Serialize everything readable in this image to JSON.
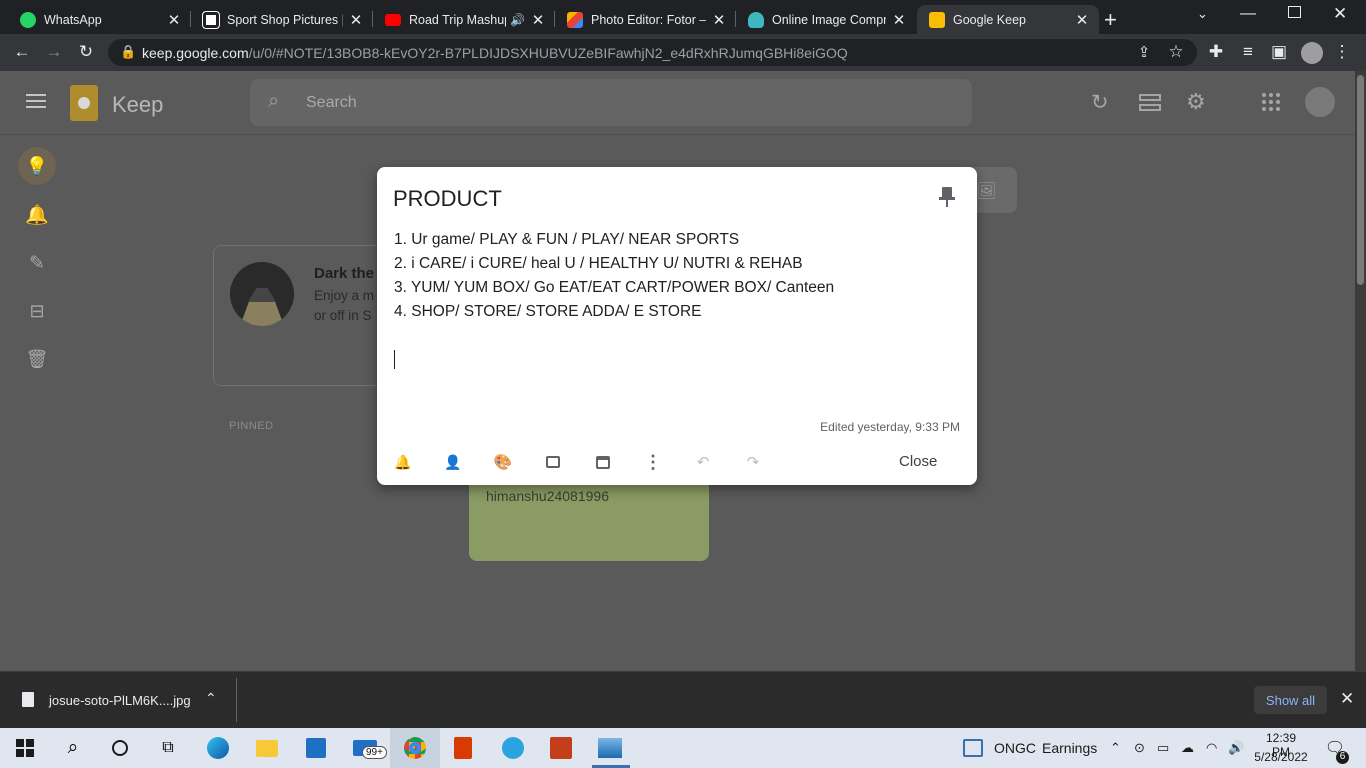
{
  "browser": {
    "tabs": [
      {
        "title": "WhatsApp",
        "icon": "whatsapp-icon",
        "color": "#25d366"
      },
      {
        "title": "Sport Shop Pictures | U",
        "icon": "unsplash-icon",
        "color": "#ffffff"
      },
      {
        "title": "Road Trip Mashup",
        "icon": "youtube-icon",
        "color": "#ff0000"
      },
      {
        "title": "Photo Editor: Fotor – F",
        "icon": "fotor-icon",
        "color": "#f4b400"
      },
      {
        "title": "Online Image Compre",
        "icon": "compressor-icon",
        "color": "#3fb7c0"
      },
      {
        "title": "Google Keep",
        "icon": "keep-icon",
        "color": "#fbbc04"
      }
    ],
    "new_tab": "+",
    "url_host": "keep.google.com",
    "url_path": "/u/0/#NOTE/13BOB8-kEvOY2r-B7PLDIJDSXHUBVUZeBIFawhjN2_e4dRxhRJumqGBHi8eiGOQ"
  },
  "keep": {
    "app_name": "Keep",
    "search_placeholder": "Search",
    "dark_card": {
      "title": "Dark the",
      "line1": "Enjoy a m",
      "line2": "or off in S"
    },
    "pinned_label": "PINNED",
    "green_note_text": "himanshu24081996"
  },
  "note": {
    "title": "PRODUCT",
    "lines": [
      "1. Ur game/ PLAY & FUN / PLAY/ NEAR SPORTS",
      "2. i CARE/  i CURE/ heal U / HEALTHY U/ NUTRI & REHAB",
      "3. YUM/ YUM BOX/ Go EAT/EAT CART/POWER BOX/ Canteen",
      "4. SHOP/ STORE/ STORE ADDA/ E STORE"
    ],
    "edited": "Edited yesterday, 9:33 PM",
    "close_label": "Close"
  },
  "download": {
    "filename": "josue-soto-PlLM6K....jpg",
    "show_all": "Show all"
  },
  "taskbar": {
    "store_badge": "99+",
    "stock_name": "ONGC",
    "stock_label": "Earnings",
    "time": "12:39 PM",
    "date": "5/28/2022",
    "notif_count": "6"
  }
}
